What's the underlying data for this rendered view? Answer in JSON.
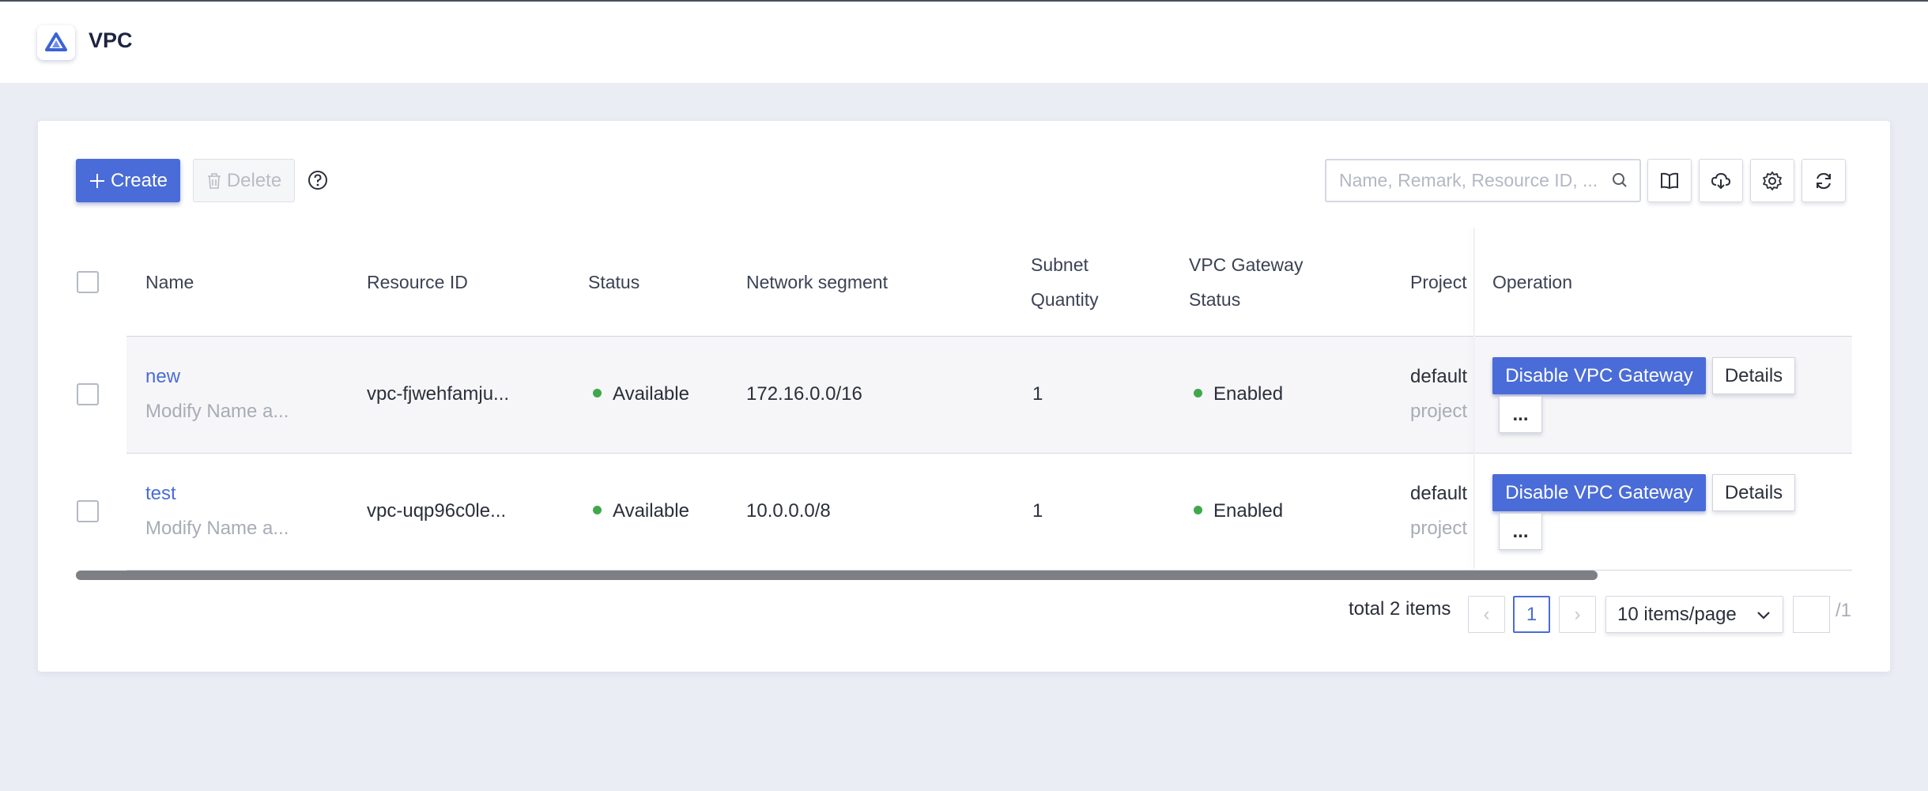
{
  "header": {
    "title": "VPC"
  },
  "toolbar": {
    "create_label": "Create",
    "delete_label": "Delete",
    "search_placeholder": "Name, Remark, Resource ID, ..."
  },
  "table": {
    "columns": {
      "name": "Name",
      "resource_id": "Resource ID",
      "status": "Status",
      "network_segment": "Network segment",
      "subnet_quantity_l1": "Subnet",
      "subnet_quantity_l2": "Quantity",
      "vpc_gateway_status_l1": "VPC Gateway",
      "vpc_gateway_status_l2": "Status",
      "project": "Project",
      "operation": "Operation"
    },
    "rows": [
      {
        "name": "new",
        "remark": "Modify Name a...",
        "resource_id": "vpc-fjwehfamju...",
        "status": "Available",
        "network_segment": "172.16.0.0/16",
        "subnet_quantity": "1",
        "gateway_status": "Enabled",
        "project": "default",
        "project_sub": "project",
        "gateway_action": "Disable VPC Gateway",
        "details": "Details",
        "more": "..."
      },
      {
        "name": "test",
        "remark": "Modify Name a...",
        "resource_id": "vpc-uqp96c0le...",
        "status": "Available",
        "network_segment": "10.0.0.0/8",
        "subnet_quantity": "1",
        "gateway_status": "Enabled",
        "project": "default",
        "project_sub": "project",
        "gateway_action": "Disable VPC Gateway",
        "details": "Details",
        "more": "..."
      }
    ]
  },
  "pagination": {
    "total": "total 2 items",
    "prev": "‹",
    "current_page": "1",
    "next": "›",
    "page_size": "10 items/page",
    "of_pages": "/1"
  },
  "colors": {
    "accent": "#4a6cd8",
    "status_ok": "#3fa84a",
    "background": "#ebedf5"
  },
  "icons": [
    "logo-icon",
    "plus-icon",
    "trash-icon",
    "help-icon",
    "search-icon",
    "book-icon",
    "cloud-download-icon",
    "gear-icon",
    "refresh-icon",
    "chevron-down-icon"
  ]
}
